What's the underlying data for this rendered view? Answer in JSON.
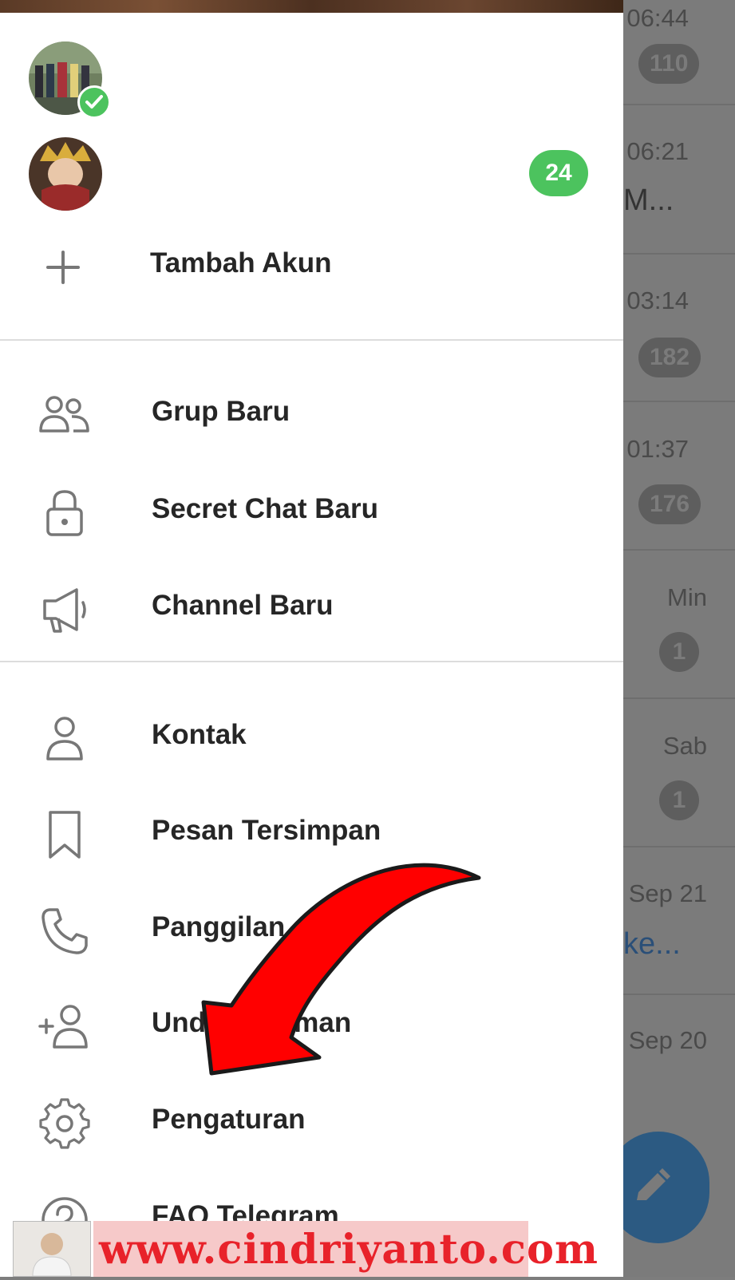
{
  "accounts": {
    "secondary_unread": "24"
  },
  "add_account_label": "Tambah Akun",
  "menu": {
    "new_group": "Grup Baru",
    "new_secret_chat": "Secret Chat Baru",
    "new_channel": "Channel Baru",
    "contacts": "Kontak",
    "saved_messages": "Pesan Tersimpan",
    "calls": "Panggilan",
    "invite_friends": "Undang Teman",
    "settings": "Pengaturan",
    "faq": "FAQ Telegram"
  },
  "chat_list": [
    {
      "time": "06:44",
      "badge": "110"
    },
    {
      "time": "06:21",
      "snippet": "M..."
    },
    {
      "time": "03:14",
      "badge": "182"
    },
    {
      "time": "01:37",
      "badge": "176"
    },
    {
      "time": "Min",
      "badge": "1"
    },
    {
      "time": "Sab",
      "badge": "1"
    },
    {
      "time": "Sep 21",
      "snippet": "ke..."
    },
    {
      "time": "Sep 20"
    }
  ],
  "watermark": "www.cindriyanto.com",
  "colors": {
    "accent_green": "#4cc35e",
    "annotation_arrow": "#ff0000",
    "fab": "#2c5a82",
    "watermark_text": "#e8222a"
  },
  "icons": [
    "plus-icon",
    "group-icon",
    "lock-icon",
    "megaphone-icon",
    "person-icon",
    "bookmark-icon",
    "phone-icon",
    "add-person-icon",
    "gear-icon",
    "help-icon",
    "pencil-icon",
    "check-icon"
  ]
}
